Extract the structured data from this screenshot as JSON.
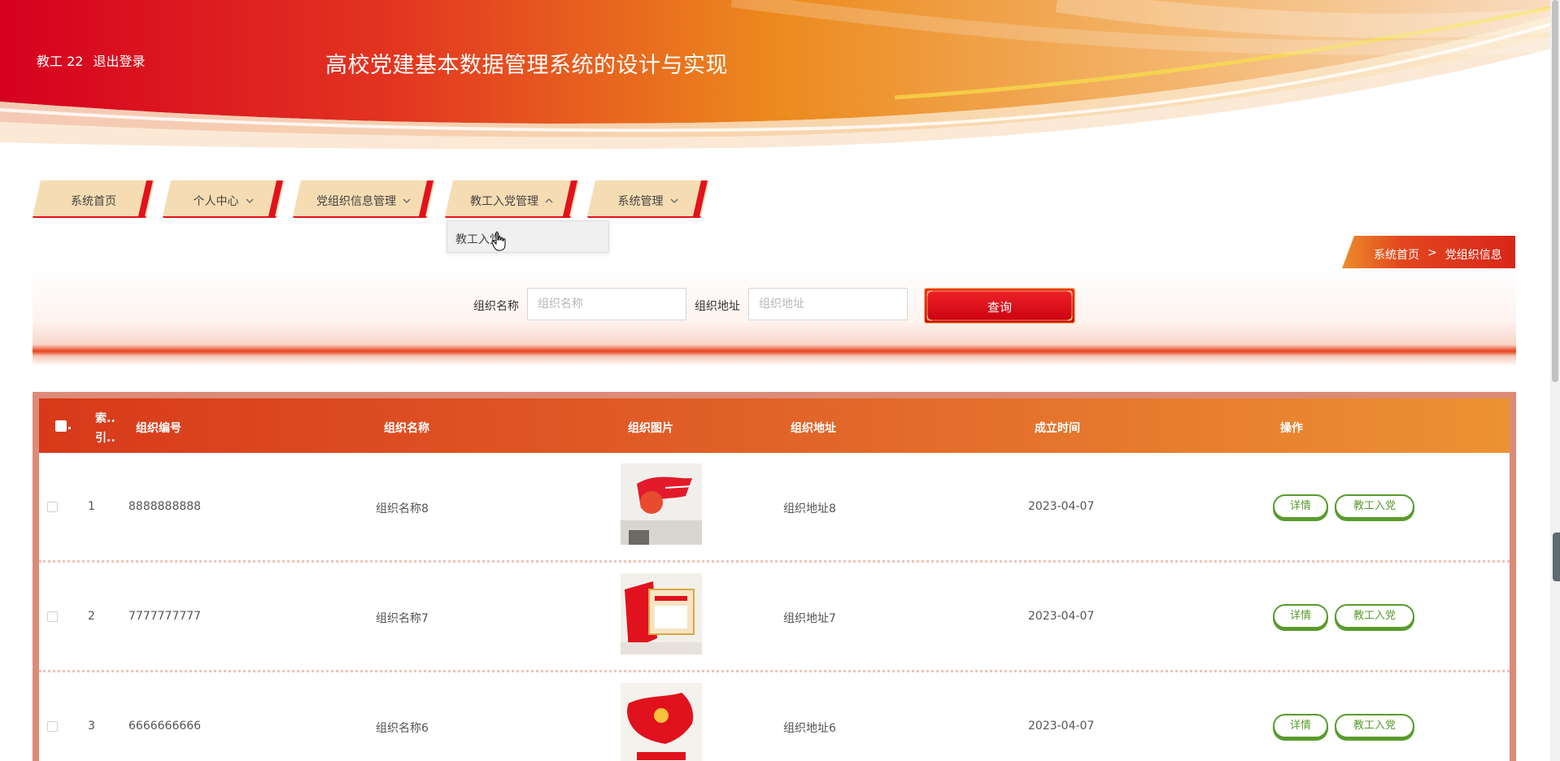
{
  "header": {
    "user_name": "教工 22",
    "logout_label": "退出登录",
    "site_title": "高校党建基本数据管理系统的设计与实现"
  },
  "nav": {
    "items": [
      {
        "label": "系统首页",
        "has_dropdown": false
      },
      {
        "label": "个人中心",
        "has_dropdown": true
      },
      {
        "label": "党组织信息管理",
        "has_dropdown": true
      },
      {
        "label": "教工入党管理",
        "has_dropdown": true,
        "expanded": true
      },
      {
        "label": "系统管理",
        "has_dropdown": true
      }
    ],
    "dropdown_items": [
      "教工入党"
    ]
  },
  "breadcrumb": {
    "home": "系统首页",
    "separator": ">",
    "current": "党组织信息"
  },
  "search": {
    "name_label": "组织名称",
    "name_placeholder": "组织名称",
    "name_value": "",
    "address_label": "组织地址",
    "address_placeholder": "组织地址",
    "address_value": "",
    "query_label": "查询"
  },
  "table": {
    "headers": {
      "index_line1": "索..",
      "index_line2": "引..",
      "code": "组织编号",
      "name": "组织名称",
      "image": "组织图片",
      "address": "组织地址",
      "date": "成立时间",
      "actions": "操作"
    },
    "rows": [
      {
        "index": "1",
        "code": "8888888888",
        "name": "组织名称8",
        "address": "组织地址8",
        "date": "2023-04-07",
        "detail_label": "详情",
        "join_label": "教工入党"
      },
      {
        "index": "2",
        "code": "7777777777",
        "name": "组织名称7",
        "address": "组织地址7",
        "date": "2023-04-07",
        "detail_label": "详情",
        "join_label": "教工入党"
      },
      {
        "index": "3",
        "code": "6666666666",
        "name": "组织名称6",
        "address": "组织地址6",
        "date": "2023-04-07",
        "detail_label": "详情",
        "join_label": "教工入党"
      }
    ]
  },
  "colors": {
    "primary_red": "#e0121d",
    "accent_orange": "#ec9233",
    "action_green": "#5a9b2e",
    "nav_tab_bg": "#f6dcb2"
  }
}
